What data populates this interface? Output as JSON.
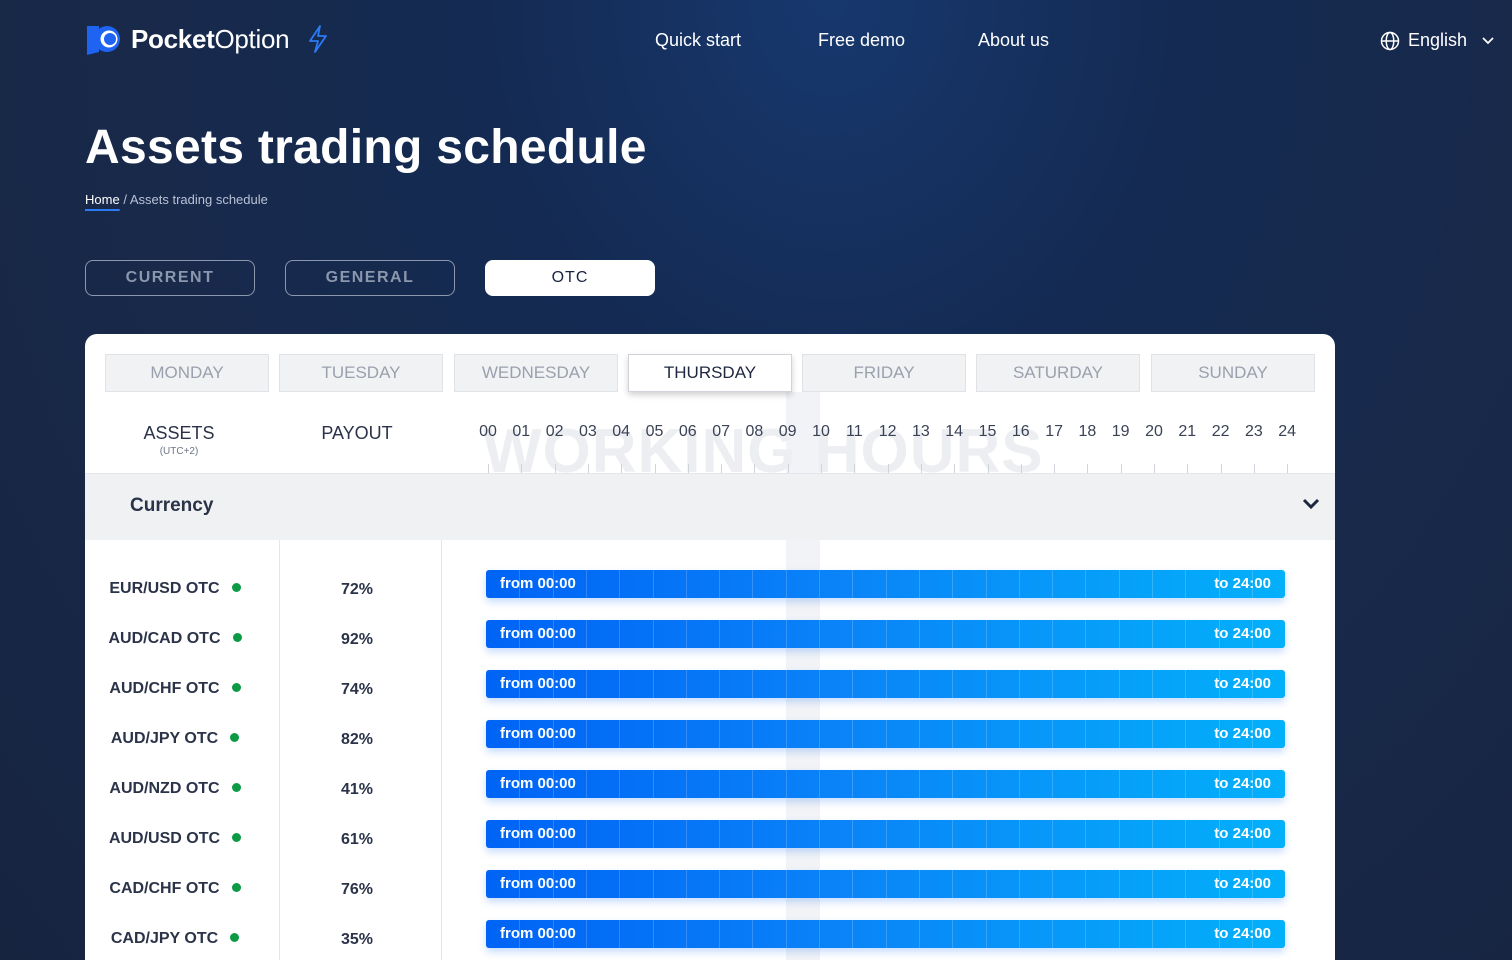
{
  "brand": {
    "name_bold": "Pocket",
    "name_regular": "Option"
  },
  "nav": {
    "items": [
      "Quick start",
      "Free demo",
      "About us"
    ]
  },
  "language": {
    "label": "English"
  },
  "page": {
    "title": "Assets trading schedule"
  },
  "breadcrumb": {
    "home": "Home",
    "separator": "/",
    "current": "Assets trading schedule"
  },
  "modes": [
    "CURRENT",
    "GENERAL",
    "OTC"
  ],
  "active_mode": "OTC",
  "days": [
    "MONDAY",
    "TUESDAY",
    "WEDNESDAY",
    "THURSDAY",
    "FRIDAY",
    "SATURDAY",
    "SUNDAY"
  ],
  "active_day": "THURSDAY",
  "table": {
    "assets_header": "ASSETS",
    "timezone": "(UTC+2)",
    "payout_header": "PAYOUT",
    "hours_watermark": "WORKING HOURS",
    "hours": [
      "00",
      "01",
      "02",
      "03",
      "04",
      "05",
      "06",
      "07",
      "08",
      "09",
      "10",
      "11",
      "12",
      "13",
      "14",
      "15",
      "16",
      "17",
      "18",
      "19",
      "20",
      "21",
      "22",
      "23",
      "24"
    ]
  },
  "category": {
    "name": "Currency"
  },
  "rows": [
    {
      "asset": "EUR/USD OTC",
      "payout": "72%",
      "from": "from 00:00",
      "to": "to 24:00"
    },
    {
      "asset": "AUD/CAD OTC",
      "payout": "92%",
      "from": "from 00:00",
      "to": "to 24:00"
    },
    {
      "asset": "AUD/CHF OTC",
      "payout": "74%",
      "from": "from 00:00",
      "to": "to 24:00"
    },
    {
      "asset": "AUD/JPY OTC",
      "payout": "82%",
      "from": "from 00:00",
      "to": "to 24:00"
    },
    {
      "asset": "AUD/NZD OTC",
      "payout": "41%",
      "from": "from 00:00",
      "to": "to 24:00"
    },
    {
      "asset": "AUD/USD OTC",
      "payout": "61%",
      "from": "from 00:00",
      "to": "to 24:00"
    },
    {
      "asset": "CAD/CHF OTC",
      "payout": "76%",
      "from": "from 00:00",
      "to": "to 24:00"
    },
    {
      "asset": "CAD/JPY OTC",
      "payout": "35%",
      "from": "from 00:00",
      "to": "to 24:00"
    }
  ],
  "colors": {
    "accent": "#0063f5",
    "bar_end": "#03b0fa",
    "status_open": "#0c9a45",
    "background": "#172440"
  }
}
